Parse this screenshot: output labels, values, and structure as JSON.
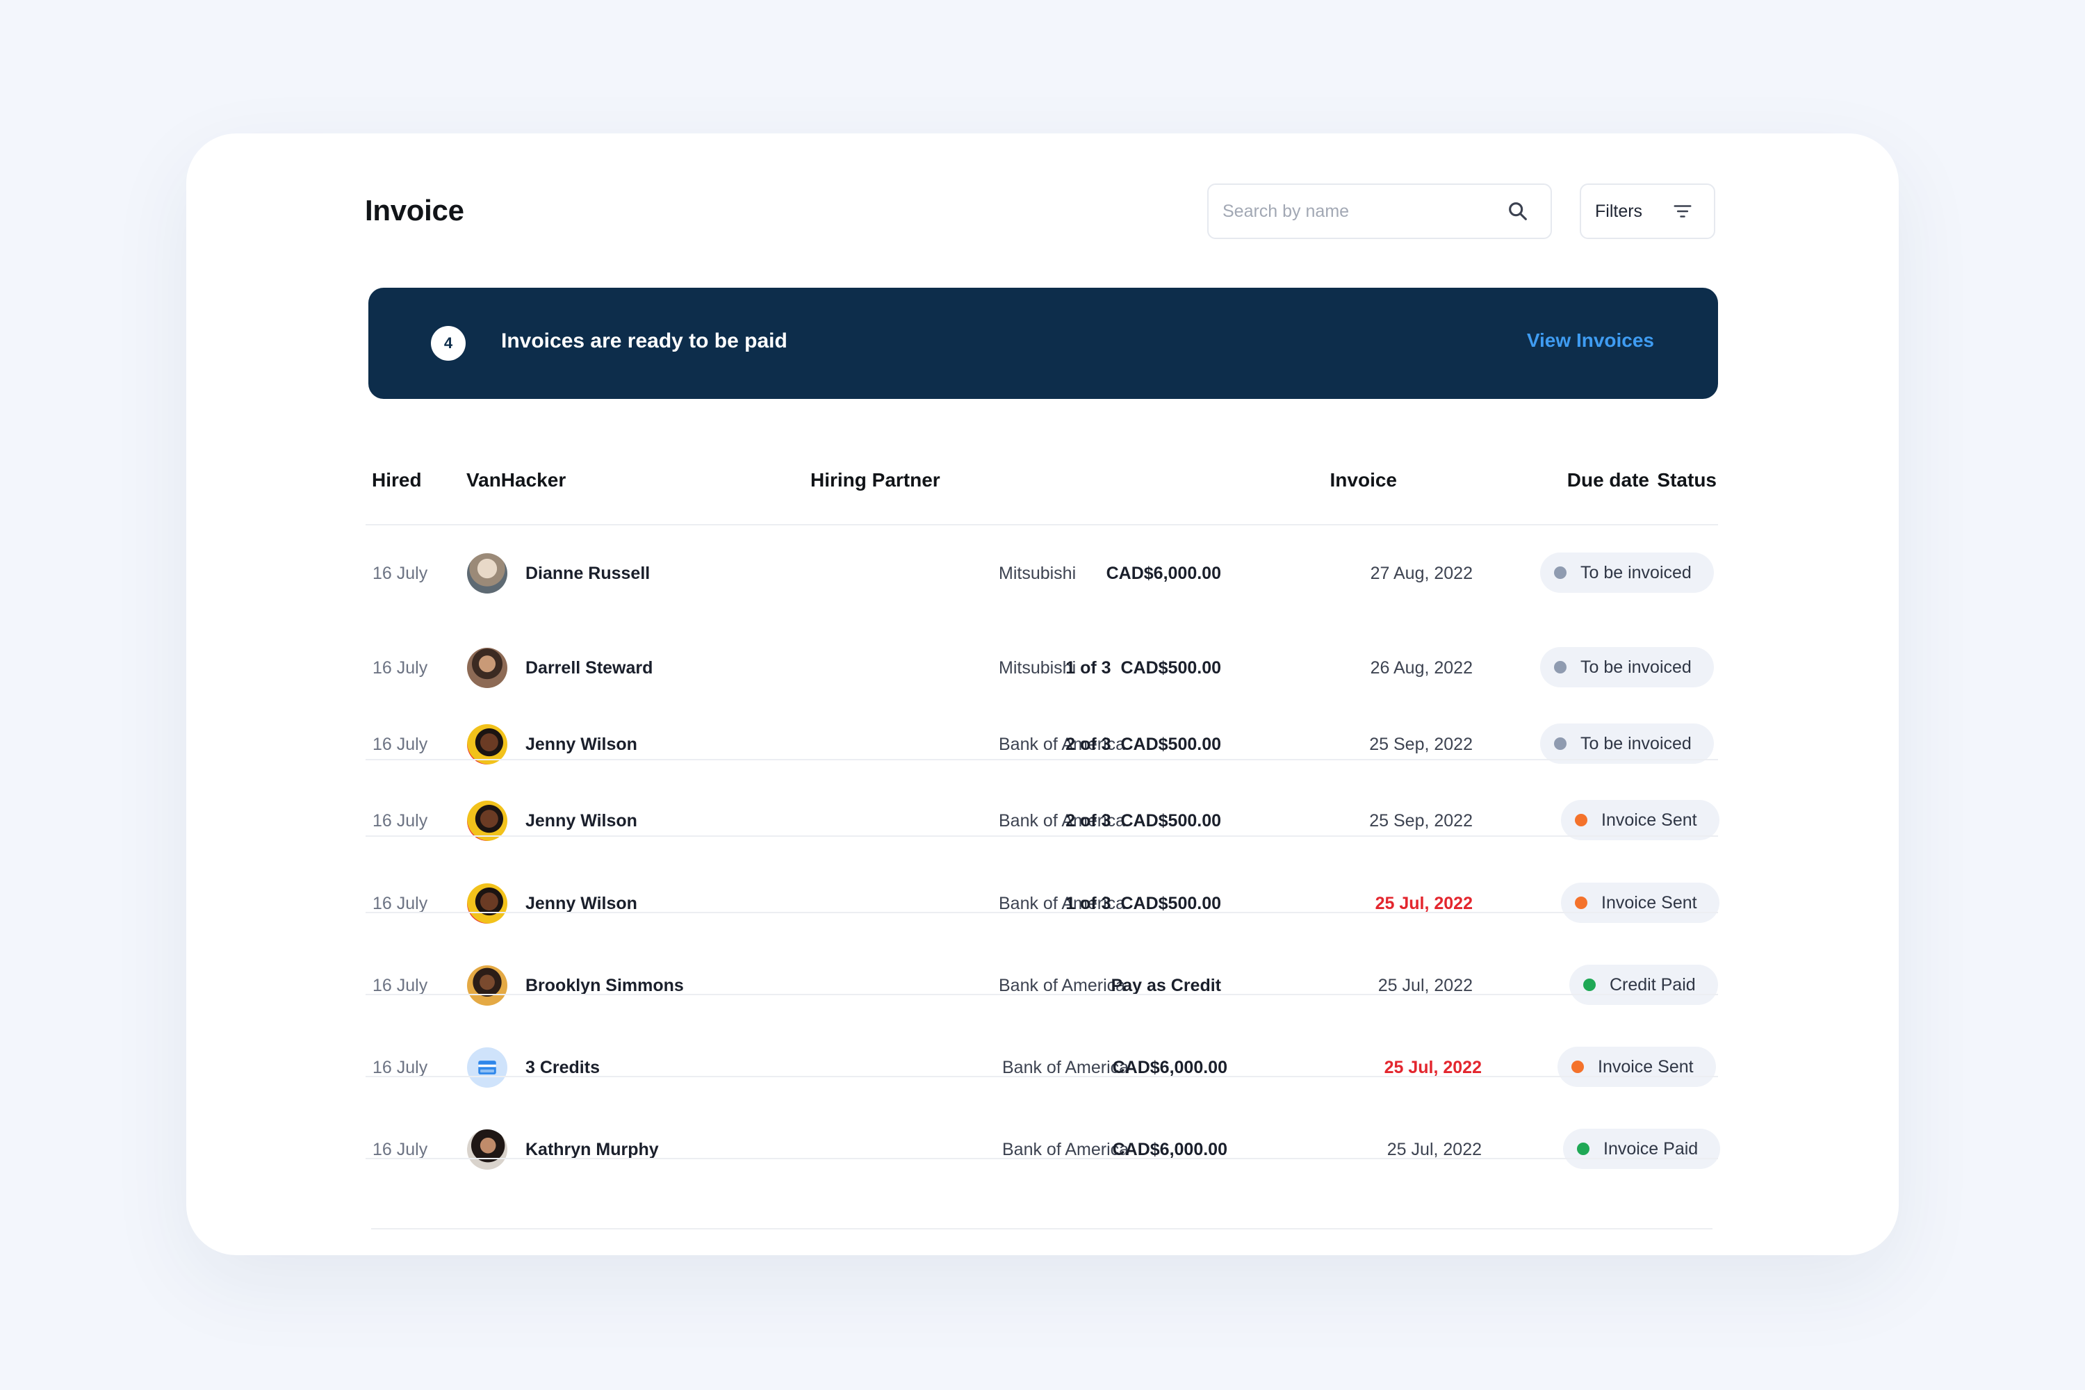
{
  "page": {
    "title": "Invoice"
  },
  "search": {
    "placeholder": "Search by name",
    "value": ""
  },
  "filters": {
    "label": "Filters"
  },
  "banner": {
    "count": "4",
    "message": "Invoices are ready to be paid",
    "link_label": "View Invoices"
  },
  "table": {
    "columns": [
      "Hired",
      "VanHacker",
      "Hiring Partner",
      "Invoice",
      "Due date",
      "Status"
    ],
    "rows": [
      {
        "hired": "16 July",
        "name": "Dianne Russell",
        "partner": "Mitsubishi",
        "invoice": "CAD$6,000.00",
        "due": "27 Aug, 2022",
        "overdue": false,
        "status": "To be invoiced",
        "status_color": "#8f9bb0",
        "avatar": "photo"
      },
      {
        "hired": "16 July",
        "name": "Darrell Steward",
        "partner": "Mitsubishi",
        "invoice": "1 of 3  CAD$500.00",
        "due": "26 Aug, 2022",
        "overdue": false,
        "status": "To be invoiced",
        "status_color": "#8f9bb0",
        "avatar": "photo"
      },
      {
        "hired": "16 July",
        "name": "Jenny Wilson",
        "partner": "Bank of America",
        "invoice": "2 of 3  CAD$500.00",
        "due": "25 Sep, 2022",
        "overdue": false,
        "status": "To be invoiced",
        "status_color": "#8f9bb0",
        "avatar": "photo"
      },
      {
        "hired": "16 July",
        "name": "Jenny Wilson",
        "partner": "Bank of America",
        "invoice": "2 of 3  CAD$500.00",
        "due": "25 Sep, 2022",
        "overdue": false,
        "status": "Invoice Sent",
        "status_color": "#f4722b",
        "avatar": "photo"
      },
      {
        "hired": "16 July",
        "name": "Jenny Wilson",
        "partner": "Bank of America",
        "invoice": "1 of 3  CAD$500.00",
        "due": "25 Jul, 2022",
        "overdue": true,
        "status": "Invoice Sent",
        "status_color": "#f4722b",
        "avatar": "photo"
      },
      {
        "hired": "16 July",
        "name": "Brooklyn Simmons",
        "partner": "Bank of America",
        "invoice": "Pay as Credit",
        "due": "25 Jul, 2022",
        "overdue": false,
        "status": "Credit Paid",
        "status_color": "#1fa855",
        "avatar": "photo"
      },
      {
        "hired": "16 July",
        "name": "3 Credits",
        "partner": "Bank of America",
        "invoice": "CAD$6,000.00",
        "due": "25 Jul, 2022",
        "overdue": true,
        "status": "Invoice Sent",
        "status_color": "#f4722b",
        "avatar": "credit-card-icon"
      },
      {
        "hired": "16 July",
        "name": "Kathryn Murphy",
        "partner": "Bank of America",
        "invoice": "CAD$6,000.00",
        "due": "25 Jul, 2022",
        "overdue": false,
        "status": "Invoice Paid",
        "status_color": "#1fa855",
        "avatar": "photo"
      }
    ]
  },
  "colors": {
    "banner_bg": "#0d2d4b",
    "link": "#3f9cf2",
    "overdue": "#e3262e",
    "status_pending": "#8f9bb0",
    "status_sent": "#f4722b",
    "status_paid": "#1fa855"
  }
}
